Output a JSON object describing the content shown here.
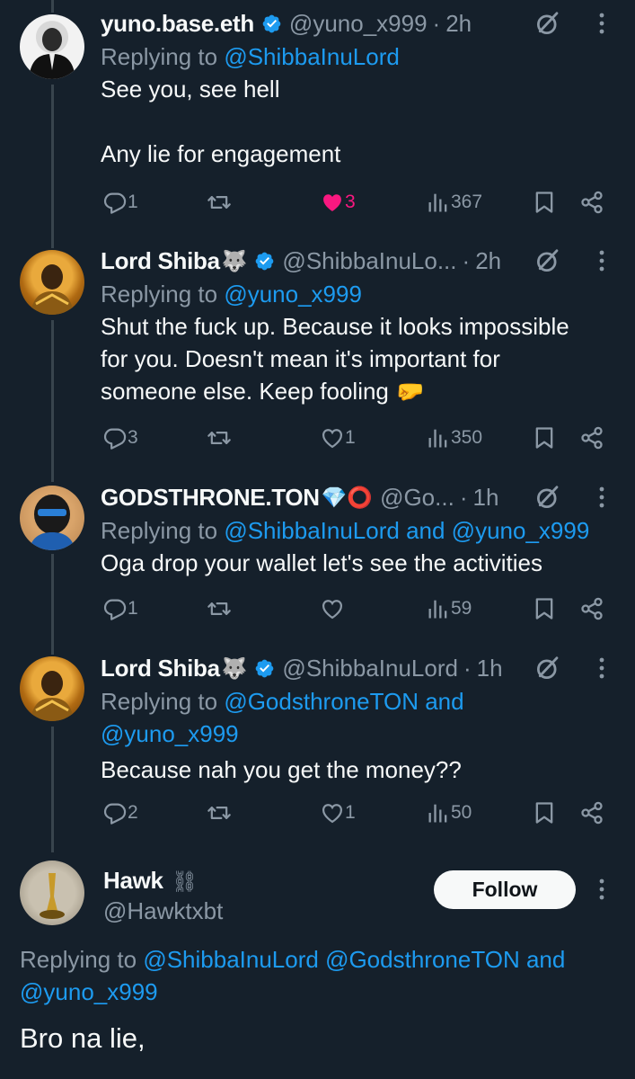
{
  "tweets": [
    {
      "name": "yuno.base.eth",
      "name_emoji": "",
      "handle": "@yuno_x999",
      "time": "2h",
      "replying_prefix": "Replying to ",
      "replying_links": "@ShibbaInuLord",
      "replying_line2": "",
      "text_lines": [
        "See you, see hell",
        "",
        "Any lie for engagement"
      ],
      "replies": "1",
      "retweets": "",
      "likes": "3",
      "views": "367"
    },
    {
      "name": "Lord Shiba",
      "name_emoji": "🐺",
      "handle": "@ShibbaInuLo...",
      "time": "2h",
      "replying_prefix": "Replying to ",
      "replying_links": "@yuno_x999",
      "replying_line2": "",
      "text_lines": [
        "Shut the fuck up. Because it looks impossible",
        "for you. Doesn't mean it's important for",
        "someone else. Keep fooling 🤛"
      ],
      "replies": "3",
      "retweets": "",
      "likes": "1",
      "views": "350"
    },
    {
      "name": "GODSTHRONE.TON",
      "name_emoji": "💎⭕",
      "handle": "@Go...",
      "time": "1h",
      "replying_prefix": "Replying to ",
      "replying_links": "@ShibbaInuLord and @yuno_x999",
      "replying_line2": "",
      "text_lines": [
        "Oga drop your wallet let's see the activities"
      ],
      "replies": "1",
      "retweets": "",
      "likes": "",
      "views": "59"
    },
    {
      "name": "Lord Shiba",
      "name_emoji": "🐺",
      "handle": "@ShibbaInuLord",
      "time": "1h",
      "replying_prefix": "Replying to ",
      "replying_links": "@GodsthroneTON and",
      "replying_line2": "@yuno_x999",
      "text_lines": [
        "Because nah you get the money??"
      ],
      "replies": "2",
      "retweets": "",
      "likes": "1",
      "views": "50"
    }
  ],
  "main_tweet": {
    "name": "Hawk",
    "name_emoji": "⛓",
    "handle": "@Hawktxbt",
    "follow_label": "Follow",
    "replying_prefix": "Replying to ",
    "replying_line1_links": "@ShibbaInuLord @GodsthroneTON and",
    "replying_line2_links": "@yuno_x999",
    "text": "Bro na lie,"
  },
  "colors": {
    "background": "#15202b",
    "text": "#f7f9f9",
    "secondary": "#8b98a5",
    "link": "#1d9bf0",
    "like": "#f91880",
    "thread_line": "#38444d"
  },
  "icons": [
    "verified-badge-icon",
    "grok-icon",
    "more-icon",
    "reply-icon",
    "retweet-icon",
    "like-icon",
    "views-icon",
    "bookmark-icon",
    "share-icon"
  ]
}
